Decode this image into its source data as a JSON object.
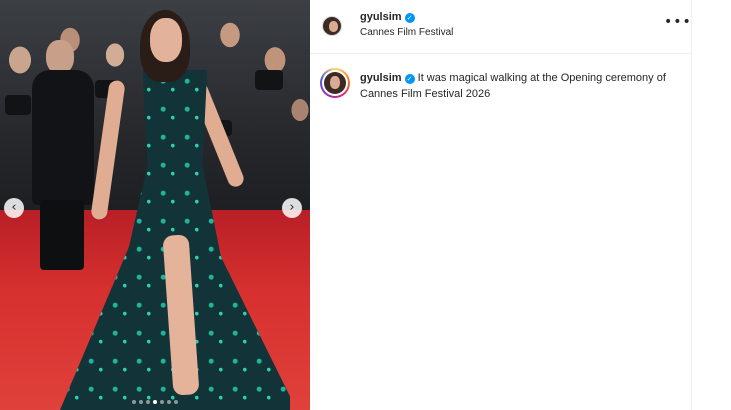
{
  "post": {
    "author": {
      "username": "gyulsim",
      "verified_icon": "verified-badge-icon",
      "location": "Cannes Film Festival"
    },
    "caption": {
      "username": "gyulsim",
      "text": "It was magical walking at the Opening ceremony of Cannes Film Festival 2026"
    },
    "media": {
      "carousel_dots": 7,
      "active_dot": 3,
      "prev_icon": "chevron-left-icon",
      "next_icon": "chevron-right-icon",
      "prev_glyph": "‹",
      "next_glyph": "›"
    },
    "more_options_glyph": "•••",
    "verified_glyph": "✓"
  },
  "colors": {
    "verified_blue": "#0095f6",
    "text": "#262626",
    "divider": "#efefef",
    "carpet_red": "#d6302f",
    "dress_teal": "#123338"
  }
}
